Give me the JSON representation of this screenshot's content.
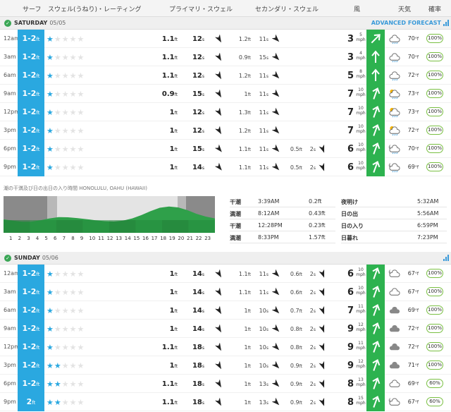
{
  "header": {
    "surf": "サーフ",
    "rating": "スウェル(うねり)・レーティング",
    "primary": "プライマリ・スウェル",
    "secondary": "セカンダリ・スウェル",
    "wind": "風",
    "weather": "天気",
    "prob": "確率"
  },
  "units": {
    "ft": "ft",
    "s": "s",
    "mph": "mph",
    "f": "°f"
  },
  "day1": {
    "label": "SATURDAY",
    "date": "05/05",
    "advanced": "ADVANCED FORECAST",
    "rows": [
      {
        "time": "12am",
        "surf": "1-2",
        "stars": 1,
        "ph": "1.1",
        "pp": "12",
        "pa": 150,
        "sh": "1.2",
        "sp": "11",
        "sa": 135,
        "th": "",
        "tp": "",
        "ta": 0,
        "wind": "3",
        "wu": "5",
        "wa": 225,
        "wx": "rain",
        "temp": "70",
        "prob": "100%"
      },
      {
        "time": "3am",
        "surf": "1-2",
        "stars": 1,
        "ph": "1.1",
        "pp": "12",
        "pa": 150,
        "sh": "0.9",
        "sp": "15",
        "sa": 135,
        "th": "",
        "tp": "",
        "ta": 0,
        "wind": "3",
        "wu": "4",
        "wa": 180,
        "wx": "rain",
        "temp": "70",
        "prob": "100%"
      },
      {
        "time": "6am",
        "surf": "1-2",
        "stars": 1,
        "ph": "1.1",
        "pp": "12",
        "pa": 150,
        "sh": "1.2",
        "sp": "11",
        "sa": 135,
        "th": "",
        "tp": "",
        "ta": 0,
        "wind": "5",
        "wu": "8",
        "wa": 180,
        "wx": "rain",
        "temp": "72",
        "prob": "100%"
      },
      {
        "time": "9am",
        "surf": "1-2",
        "stars": 1,
        "ph": "0.9",
        "pp": "15",
        "pa": 150,
        "sh": "1",
        "sp": "11",
        "sa": 135,
        "th": "",
        "tp": "",
        "ta": 0,
        "wind": "7",
        "wu": "10",
        "wa": 200,
        "wx": "sunrain",
        "temp": "73",
        "prob": "100%"
      },
      {
        "time": "12pm",
        "surf": "1-2",
        "stars": 1,
        "ph": "1",
        "pp": "12",
        "pa": 150,
        "sh": "1.3",
        "sp": "11",
        "sa": 135,
        "th": "",
        "tp": "",
        "ta": 0,
        "wind": "7",
        "wu": "10",
        "wa": 200,
        "wx": "sunrain",
        "temp": "73",
        "prob": "100%"
      },
      {
        "time": "3pm",
        "surf": "1-2",
        "stars": 1,
        "ph": "1",
        "pp": "12",
        "pa": 150,
        "sh": "1.2",
        "sp": "11",
        "sa": 135,
        "th": "",
        "tp": "",
        "ta": 0,
        "wind": "7",
        "wu": "10",
        "wa": 200,
        "wx": "sunrain",
        "temp": "72",
        "prob": "100%"
      },
      {
        "time": "6pm",
        "surf": "1-2",
        "stars": 1,
        "ph": "1",
        "pp": "15",
        "pa": 140,
        "sh": "1.1",
        "sp": "11",
        "sa": 135,
        "th": "0.5",
        "tp": "2",
        "ta": 160,
        "wind": "6",
        "wu": "10",
        "wa": 200,
        "wx": "nightrain",
        "temp": "70",
        "prob": "100%"
      },
      {
        "time": "9pm",
        "surf": "1-2",
        "stars": 1,
        "ph": "1",
        "pp": "14",
        "pa": 140,
        "sh": "1.1",
        "sp": "11",
        "sa": 135,
        "th": "0.5",
        "tp": "2",
        "ta": 160,
        "wind": "6",
        "wu": "10",
        "wa": 200,
        "wx": "nightrain",
        "temp": "69",
        "prob": "100%"
      }
    ]
  },
  "tide": {
    "title": "潮の干満及び日の出日の入り時間 HONOLULU, OAHU (HAWAII)",
    "hours": [
      "1",
      "2",
      "3",
      "4",
      "5",
      "6",
      "7",
      "8",
      "9",
      "10",
      "11",
      "12",
      "13",
      "14",
      "15",
      "16",
      "17",
      "18",
      "19",
      "20",
      "21",
      "22",
      "23"
    ],
    "levels": [
      0.35,
      0.28,
      0.22,
      0.22,
      0.3,
      0.4,
      0.47,
      0.46,
      0.42,
      0.36,
      0.3,
      0.25,
      0.23,
      0.28,
      0.4,
      0.58,
      0.8,
      0.98,
      1.05,
      1.0,
      0.85,
      0.65,
      0.5,
      0.4
    ],
    "tides": [
      {
        "type": "干潮",
        "time": "3:39AM",
        "height": "0.2ft"
      },
      {
        "type": "満潮",
        "time": "8:12AM",
        "height": "0.43ft"
      },
      {
        "type": "干潮",
        "time": "12:28PM",
        "height": "0.23ft"
      },
      {
        "type": "満潮",
        "time": "8:33PM",
        "height": "1.57ft"
      }
    ],
    "sun": [
      {
        "type": "夜明け",
        "time": "5:32AM"
      },
      {
        "type": "日の出",
        "time": "5:56AM"
      },
      {
        "type": "日の入り",
        "time": "6:59PM"
      },
      {
        "type": "日暮れ",
        "time": "7:23PM"
      }
    ]
  },
  "day2": {
    "label": "SUNDAY",
    "date": "05/06",
    "rows": [
      {
        "time": "12am",
        "surf": "1-2",
        "stars": 1,
        "ph": "1",
        "pp": "14",
        "pa": 150,
        "sh": "1.1",
        "sp": "11",
        "sa": 135,
        "th": "0.6",
        "tp": "2",
        "ta": 160,
        "wind": "6",
        "wu": "10",
        "wa": 200,
        "wx": "nightcloud",
        "temp": "67",
        "prob": "100%"
      },
      {
        "time": "3am",
        "surf": "1-2",
        "stars": 1,
        "ph": "1",
        "pp": "14",
        "pa": 150,
        "sh": "1.1",
        "sp": "11",
        "sa": 135,
        "th": "0.6",
        "tp": "2",
        "ta": 160,
        "wind": "6",
        "wu": "10",
        "wa": 200,
        "wx": "cloud",
        "temp": "67",
        "prob": "100%"
      },
      {
        "time": "6am",
        "surf": "1-2",
        "stars": 1,
        "ph": "1",
        "pp": "14",
        "pa": 150,
        "sh": "1",
        "sp": "10",
        "sa": 135,
        "th": "0.7",
        "tp": "2",
        "ta": 160,
        "wind": "7",
        "wu": "11",
        "wa": 200,
        "wx": "cloudfill",
        "temp": "69",
        "prob": "100%"
      },
      {
        "time": "9am",
        "surf": "1-2",
        "stars": 1,
        "ph": "1",
        "pp": "14",
        "pa": 150,
        "sh": "1",
        "sp": "10",
        "sa": 135,
        "th": "0.8",
        "tp": "2",
        "ta": 160,
        "wind": "9",
        "wu": "12",
        "wa": 200,
        "wx": "cloudfill",
        "temp": "72",
        "prob": "100%"
      },
      {
        "time": "12pm",
        "surf": "1-2",
        "stars": 1,
        "ph": "1.1",
        "pp": "18",
        "pa": 150,
        "sh": "1",
        "sp": "10",
        "sa": 135,
        "th": "0.8",
        "tp": "2",
        "ta": 160,
        "wind": "9",
        "wu": "11",
        "wa": 200,
        "wx": "cloudfill",
        "temp": "72",
        "prob": "100%"
      },
      {
        "time": "3pm",
        "surf": "1-2",
        "stars": 2,
        "ph": "1",
        "pp": "18",
        "pa": 150,
        "sh": "1",
        "sp": "10",
        "sa": 135,
        "th": "0.9",
        "tp": "2",
        "ta": 160,
        "wind": "9",
        "wu": "12",
        "wa": 200,
        "wx": "cloudfill",
        "temp": "71",
        "prob": "100%"
      },
      {
        "time": "6pm",
        "surf": "1-2",
        "stars": 2,
        "ph": "1.1",
        "pp": "18",
        "pa": 150,
        "sh": "1",
        "sp": "13",
        "sa": 135,
        "th": "0.9",
        "tp": "2",
        "ta": 160,
        "wind": "8",
        "wu": "13",
        "wa": 200,
        "wx": "cloud",
        "temp": "69",
        "prob": "60%"
      },
      {
        "time": "9pm",
        "surf": "2",
        "stars": 2,
        "ph": "1.1",
        "pp": "18",
        "pa": 150,
        "sh": "1",
        "sp": "13",
        "sa": 135,
        "th": "0.9",
        "tp": "2",
        "ta": 160,
        "wind": "8",
        "wu": "15",
        "wa": 200,
        "wx": "nightcloud",
        "temp": "67",
        "prob": "60%"
      }
    ]
  }
}
